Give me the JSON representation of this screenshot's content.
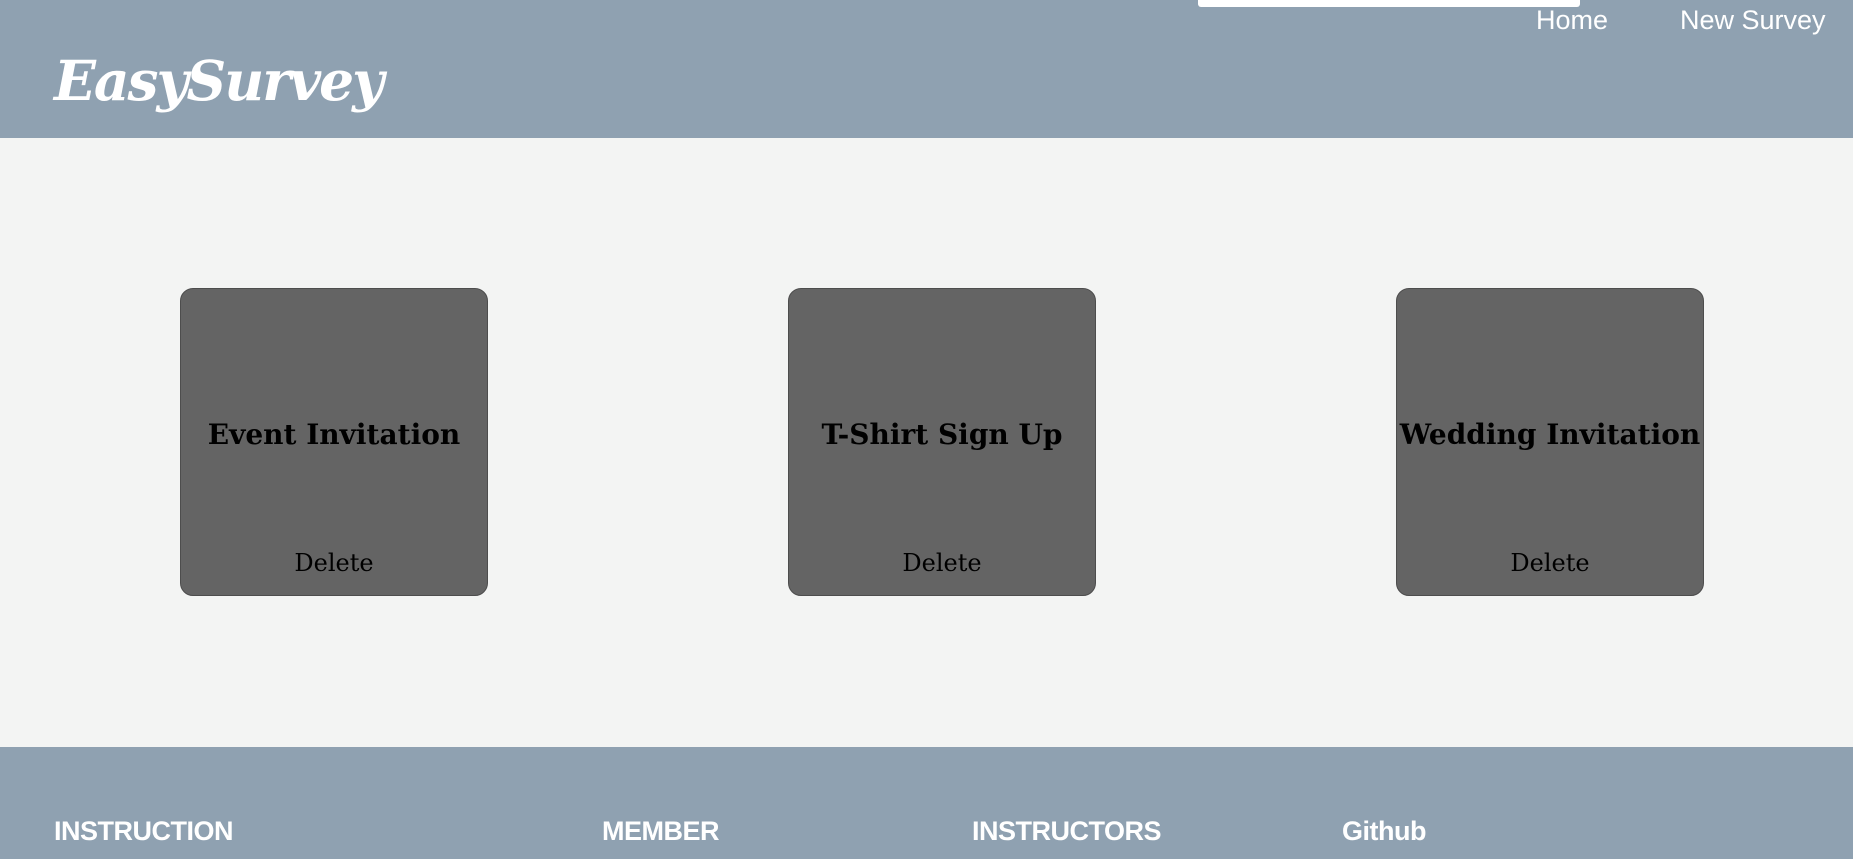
{
  "header": {
    "logo": "EasySurvey",
    "nav": {
      "home": "Home",
      "new_survey": "New Survey"
    }
  },
  "surveys": [
    {
      "title": "Event Invitation",
      "delete_label": "Delete"
    },
    {
      "title": "T-Shirt Sign Up",
      "delete_label": "Delete"
    },
    {
      "title": "Wedding Invitation",
      "delete_label": "Delete"
    }
  ],
  "footer": {
    "headings": [
      "INSTRUCTION",
      "MEMBER",
      "INSTRUCTORS",
      "Github"
    ]
  },
  "colors": {
    "header_bg": "#8fa1b1",
    "page_bg": "#f3f4f3",
    "card_bg": "#646464",
    "text_light": "#ffffff",
    "text_dark": "#000000"
  }
}
